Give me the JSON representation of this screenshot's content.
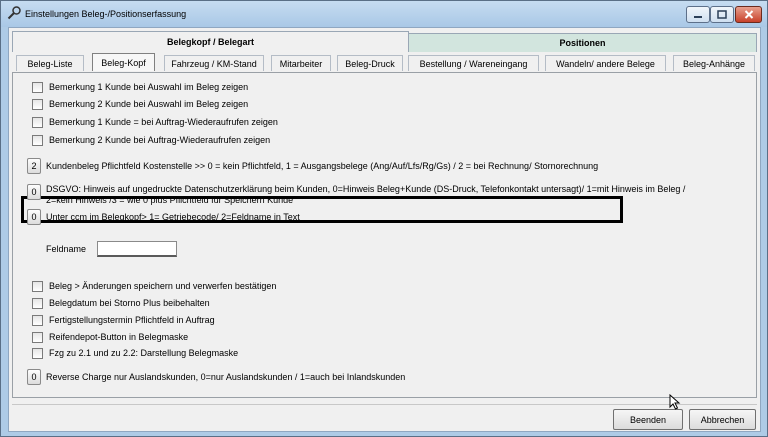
{
  "window": {
    "title": "Einstellungen Beleg-/Positionserfassung",
    "title_icon": "wrench-icon",
    "minimize_icon": "minimize-icon",
    "maximize_icon": "maximize-icon",
    "close_icon": "close-icon"
  },
  "main_tabs": [
    {
      "label": "Belegkopf / Belegart",
      "active": true
    },
    {
      "label": "Positionen",
      "active": false
    }
  ],
  "sub_tabs": [
    {
      "label": "Beleg-Liste"
    },
    {
      "label": "Beleg-Kopf"
    },
    {
      "label": "Fahrzeug / KM-Stand"
    },
    {
      "label": "Mitarbeiter"
    },
    {
      "label": "Beleg-Druck"
    },
    {
      "label": "Bestellung / Wareneingang"
    },
    {
      "label": "Wandeln/ andere Belege"
    },
    {
      "label": "Beleg-Anhänge"
    }
  ],
  "active_sub_tab": "Beleg-Kopf",
  "checkboxes_top": [
    {
      "label": "Bemerkung 1 Kunde bei Auswahl im Beleg zeigen",
      "checked": false
    },
    {
      "label": "Bemerkung 2 Kunde bei Auswahl im Beleg zeigen",
      "checked": false
    },
    {
      "label": "Bemerkung 1 Kunde = bei Auftrag-Wiederaufrufen zeigen",
      "checked": false
    },
    {
      "label": "Bemerkung 2 Kunde bei Auftrag-Wiederaufrufen zeigen",
      "checked": false
    }
  ],
  "kostenstelle": {
    "value": "2",
    "label": "Kundenbeleg Pflichtfeld Kostenstelle >> 0 = kein Pflichtfeld, 1 = Ausgangsbelege (Ang/Auf/Lfs/Rg/Gs) / 2 = bei Rechnung/ Stornorechnung"
  },
  "dsgvo": {
    "value": "0",
    "line1": "DSGVO: Hinweis auf ungedruckte Datenschutzerklärung beim Kunden, 0=Hinweis Beleg+Kunde (DS-Druck, Telefonkontakt untersagt)/ 1=mit Hinweis im Beleg /",
    "line2": "2=kein Hinweis /3 = wie 0 plus Pflichtfeld für Speichern Kunde"
  },
  "ccm": {
    "value": "0",
    "label": "Unter ccm im Belegkopf> 1= Getriebecode/ 2=Feldname in Text"
  },
  "feldname": {
    "label": "Feldname",
    "value": ""
  },
  "checkboxes_bottom": [
    {
      "label": "Beleg > Änderungen speichern und verwerfen bestätigen",
      "checked": false
    },
    {
      "label": "Belegdatum bei Storno Plus beibehalten",
      "checked": false
    },
    {
      "label": "Fertigstellungstermin Pflichtfeld in Auftrag",
      "checked": false
    },
    {
      "label": "Reifendepot-Button in Belegmaske",
      "checked": false
    },
    {
      "label": "Fzg zu 2.1 und zu 2.2: Darstellung Belegmaske",
      "checked": false
    }
  ],
  "reverse_charge": {
    "value": "0",
    "label": "Reverse Charge nur Auslandskunden, 0=nur Auslandskunden / 1=auch bei Inlandskunden"
  },
  "buttons": {
    "beenden": "Beenden",
    "abbrechen": "Abbrechen"
  }
}
